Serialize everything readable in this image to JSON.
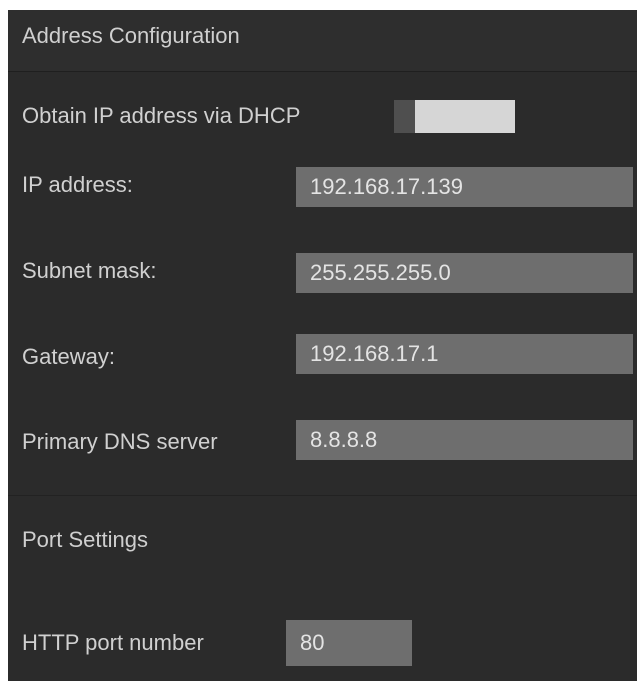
{
  "address_config": {
    "title": "Address Configuration",
    "dhcp_label": "Obtain IP address via DHCP",
    "dhcp_enabled": false,
    "ip_label": "IP address:",
    "ip_value": "192.168.17.139",
    "subnet_label": "Subnet mask:",
    "subnet_value": "255.255.255.0",
    "gateway_label": "Gateway:",
    "gateway_value": "192.168.17.1",
    "dns_label": "Primary DNS server",
    "dns_value": "8.8.8.8"
  },
  "port_settings": {
    "title": "Port Settings",
    "http_label": "HTTP port number",
    "http_value": "80"
  },
  "colors": {
    "panel_bg": "#2b2b2b",
    "field_bg": "#6e6e6e",
    "toggle_track": "#d6d6d6",
    "toggle_knob": "#4f4f4f",
    "text": "#d0d0d0"
  }
}
